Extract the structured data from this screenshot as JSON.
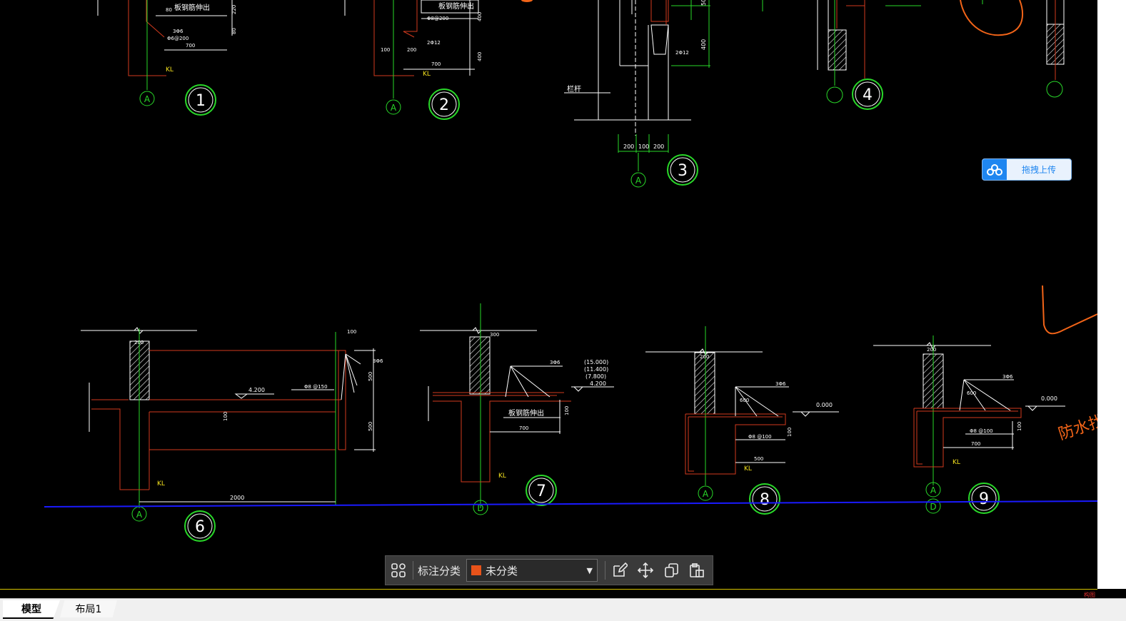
{
  "drawing": {
    "details": [
      {
        "number": "1",
        "axis": "A",
        "notes": [
          "板钢筋伸出",
          "3Φ6",
          "Φ6@200",
          "700",
          "KL",
          "80",
          "220",
          "80"
        ]
      },
      {
        "number": "2",
        "axis": "A",
        "notes": [
          "板钢筋伸出",
          "Φ8@200",
          "2Φ12",
          "100",
          "200",
          "700",
          "KL",
          "400",
          "400"
        ]
      },
      {
        "number": "3",
        "axis": "A",
        "notes": [
          "栏杆",
          "200",
          "100",
          "200",
          "2Φ12",
          "400",
          "50"
        ]
      },
      {
        "number": "4",
        "axis": "",
        "notes": []
      },
      {
        "number": "6",
        "axis": "A",
        "notes": [
          "200",
          "100",
          "4.200",
          "Φ8 @150",
          "3Φ6",
          "500",
          "500",
          "100",
          "KL",
          "2000"
        ]
      },
      {
        "number": "7",
        "axis": "D",
        "notes": [
          "300",
          "3Φ6",
          "(15.000)",
          "(11.400)",
          "(7.800)",
          "4.200",
          "板钢筋伸出",
          "700",
          "100",
          "KL"
        ]
      },
      {
        "number": "8",
        "axis": "A",
        "notes": [
          "200",
          "3Φ6",
          "600",
          "0.000",
          "Φ8 @100",
          "100",
          "500",
          "KL"
        ]
      },
      {
        "number": "9",
        "axis": "A",
        "axis2": "D",
        "notes": [
          "200",
          "3Φ6",
          "600",
          "0.000",
          "Φ8 @100",
          "100",
          "700",
          "KL"
        ]
      }
    ],
    "handwriting": "防水找坡"
  },
  "upload_button": {
    "label": "拖拽上传",
    "icon": "cloud-icon"
  },
  "toolbar": {
    "label": "标注分类",
    "select_value": "未分类",
    "select_color": "#e8531a",
    "icons": [
      "grid-icon",
      "edit-icon",
      "move-icon",
      "copy-icon",
      "paste-icon"
    ]
  },
  "tabs": [
    {
      "label": "模型",
      "active": true
    },
    {
      "label": "布局1",
      "active": false
    }
  ],
  "corner_text": "构图",
  "colors": {
    "background": "#000000",
    "green": "#29d829",
    "red": "#d23a1e",
    "white": "#ffffff",
    "blue": "#1a1aff",
    "orange": "#f26418",
    "yellow": "#f2e01e"
  }
}
